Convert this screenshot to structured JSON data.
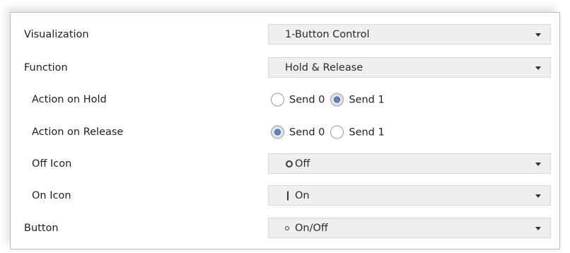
{
  "rows": [
    {
      "label": "Visualization",
      "type": "select",
      "value": "1-Button Control"
    },
    {
      "label": "Function",
      "type": "select",
      "value": "Hold & Release"
    },
    {
      "label": "Action on Hold",
      "type": "radio",
      "options": [
        "Send 0",
        "Send 1"
      ],
      "selected": "Send 1"
    },
    {
      "label": "Action on Release",
      "type": "radio",
      "options": [
        "Send 0",
        "Send 1"
      ],
      "selected": "Send 0"
    },
    {
      "label": "Off Icon",
      "type": "select",
      "value": "Off",
      "icon": "ring-icon"
    },
    {
      "label": "On Icon",
      "type": "select",
      "value": "On",
      "icon": "bar-icon"
    },
    {
      "label": "Button",
      "type": "select",
      "value": "On/Off",
      "icon": "small-ring-icon"
    }
  ],
  "colors": {
    "radio_selected": "#5b84c4",
    "select_background": "#efefef",
    "border": "#bdbdbd"
  }
}
